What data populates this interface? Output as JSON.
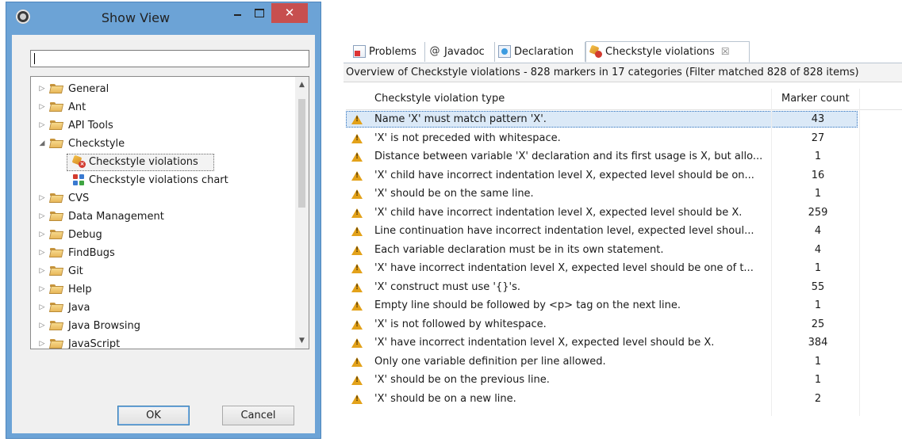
{
  "dialog": {
    "title": "Show View",
    "close_glyph": "✕",
    "filter_value": "",
    "ok_label": "OK",
    "cancel_label": "Cancel",
    "tree": [
      {
        "label": "General",
        "expanded": false,
        "level": 0
      },
      {
        "label": "Ant",
        "expanded": false,
        "level": 0
      },
      {
        "label": "API Tools",
        "expanded": false,
        "level": 0
      },
      {
        "label": "Checkstyle",
        "expanded": true,
        "level": 0
      },
      {
        "label": "Checkstyle violations",
        "level": 1,
        "icon": "checkstyle-violations-icon",
        "selected": true
      },
      {
        "label": "Checkstyle violations chart",
        "level": 1,
        "icon": "checkstyle-chart-icon"
      },
      {
        "label": "CVS",
        "expanded": false,
        "level": 0
      },
      {
        "label": "Data Management",
        "expanded": false,
        "level": 0
      },
      {
        "label": "Debug",
        "expanded": false,
        "level": 0
      },
      {
        "label": "FindBugs",
        "expanded": false,
        "level": 0
      },
      {
        "label": "Git",
        "expanded": false,
        "level": 0
      },
      {
        "label": "Help",
        "expanded": false,
        "level": 0
      },
      {
        "label": "Java",
        "expanded": false,
        "level": 0
      },
      {
        "label": "Java Browsing",
        "expanded": false,
        "level": 0
      },
      {
        "label": "JavaScript",
        "expanded": false,
        "level": 0
      }
    ]
  },
  "view": {
    "tabs": [
      {
        "label": "Problems",
        "icon": "problems-icon"
      },
      {
        "label": "Javadoc",
        "icon": "at-icon",
        "glyph": "@"
      },
      {
        "label": "Declaration",
        "icon": "declaration-icon"
      },
      {
        "label": "Checkstyle violations",
        "icon": "checkstyle-violations-icon",
        "active": true,
        "close": "☒"
      }
    ],
    "summary": "Overview of Checkstyle violations - 828 markers in 17 categories (Filter matched 828 of 828 items)",
    "columns": {
      "type": "Checkstyle violation type",
      "count": "Marker count"
    },
    "rows": [
      {
        "type": "Name 'X' must match pattern 'X'.",
        "count": "43",
        "selected": true
      },
      {
        "type": "'X' is not preceded with whitespace.",
        "count": "27"
      },
      {
        "type": "Distance between variable 'X' declaration and its first usage is X, but allo...",
        "count": "1"
      },
      {
        "type": "'X' child have incorrect indentation level X, expected level should be on...",
        "count": "16"
      },
      {
        "type": "'X' should be on the same line.",
        "count": "1"
      },
      {
        "type": "'X' child have incorrect indentation level X, expected level should be X.",
        "count": "259"
      },
      {
        "type": "Line continuation have incorrect indentation level, expected level shoul...",
        "count": "4"
      },
      {
        "type": "Each variable declaration must be in its own statement.",
        "count": "4"
      },
      {
        "type": "'X' have incorrect indentation level X, expected level should be one of t...",
        "count": "1"
      },
      {
        "type": "'X' construct must use '{}'s.",
        "count": "55"
      },
      {
        "type": "Empty line should be followed by <p> tag on the next line.",
        "count": "1"
      },
      {
        "type": "'X' is not followed by whitespace.",
        "count": "25"
      },
      {
        "type": "'X' have incorrect indentation level X, expected level should be X.",
        "count": "384"
      },
      {
        "type": "Only one variable definition per line allowed.",
        "count": "1"
      },
      {
        "type": "'X' should be on the previous line.",
        "count": "1"
      },
      {
        "type": "'X' should be on a new line.",
        "count": "2"
      }
    ]
  }
}
